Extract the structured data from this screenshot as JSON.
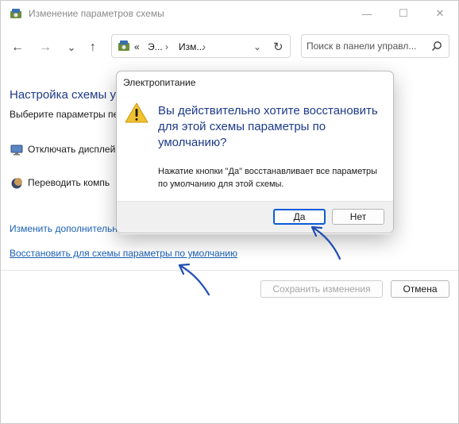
{
  "window": {
    "title": "Изменение параметров схемы",
    "app_icon": "power-options-icon",
    "controls": {
      "minimize": "—",
      "maximize": "☐",
      "close": "✕"
    }
  },
  "navigation": {
    "back": "←",
    "forward": "→",
    "recent": "⌄",
    "up": "↑",
    "address": {
      "icon": "control-panel-icon",
      "prefix": "«",
      "crumb1": "Э...",
      "crumb2": "Изм...",
      "dropdown": "⌄",
      "refresh": "↻"
    },
    "search_placeholder": "Поиск в панели управл..."
  },
  "main": {
    "heading": "Настройка схемы у",
    "subtitle": "Выберите параметры пе",
    "option_display": "Отключать дисплей",
    "option_sleep": "Переводить компь",
    "link_advanced": "Изменить дополнительные",
    "link_restore": "Восстановить для схемы параметры по умолчанию",
    "save_button": "Сохранить изменения",
    "cancel_button": "Отмена"
  },
  "dialog": {
    "title": "Электропитание",
    "question": "Вы действительно хотите восстановить для этой схемы параметры по умолчанию?",
    "description": "Нажатие кнопки \"Да\" восстанавливает все параметры по умолчанию для этой схемы.",
    "yes_button": "Да",
    "no_button": "Нет",
    "icon": "warning-icon"
  },
  "colors": {
    "heading_blue": "#1e3a8a",
    "link_blue": "#1a5fb4",
    "default_button_border": "#0b5cd5",
    "warning_yellow": "#f2c12e",
    "annotation_arrow": "#1f4fb3"
  }
}
